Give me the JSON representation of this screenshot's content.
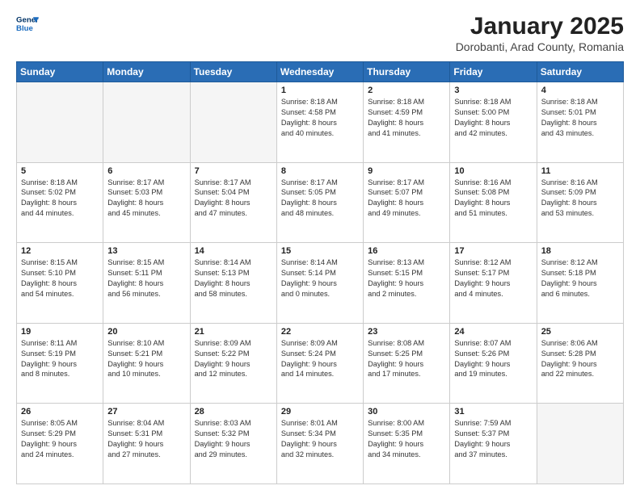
{
  "logo": {
    "line1": "General",
    "line2": "Blue"
  },
  "title": "January 2025",
  "subtitle": "Dorobanti, Arad County, Romania",
  "weekdays": [
    "Sunday",
    "Monday",
    "Tuesday",
    "Wednesday",
    "Thursday",
    "Friday",
    "Saturday"
  ],
  "weeks": [
    [
      {
        "day": "",
        "info": ""
      },
      {
        "day": "",
        "info": ""
      },
      {
        "day": "",
        "info": ""
      },
      {
        "day": "1",
        "info": "Sunrise: 8:18 AM\nSunset: 4:58 PM\nDaylight: 8 hours\nand 40 minutes."
      },
      {
        "day": "2",
        "info": "Sunrise: 8:18 AM\nSunset: 4:59 PM\nDaylight: 8 hours\nand 41 minutes."
      },
      {
        "day": "3",
        "info": "Sunrise: 8:18 AM\nSunset: 5:00 PM\nDaylight: 8 hours\nand 42 minutes."
      },
      {
        "day": "4",
        "info": "Sunrise: 8:18 AM\nSunset: 5:01 PM\nDaylight: 8 hours\nand 43 minutes."
      }
    ],
    [
      {
        "day": "5",
        "info": "Sunrise: 8:18 AM\nSunset: 5:02 PM\nDaylight: 8 hours\nand 44 minutes."
      },
      {
        "day": "6",
        "info": "Sunrise: 8:17 AM\nSunset: 5:03 PM\nDaylight: 8 hours\nand 45 minutes."
      },
      {
        "day": "7",
        "info": "Sunrise: 8:17 AM\nSunset: 5:04 PM\nDaylight: 8 hours\nand 47 minutes."
      },
      {
        "day": "8",
        "info": "Sunrise: 8:17 AM\nSunset: 5:05 PM\nDaylight: 8 hours\nand 48 minutes."
      },
      {
        "day": "9",
        "info": "Sunrise: 8:17 AM\nSunset: 5:07 PM\nDaylight: 8 hours\nand 49 minutes."
      },
      {
        "day": "10",
        "info": "Sunrise: 8:16 AM\nSunset: 5:08 PM\nDaylight: 8 hours\nand 51 minutes."
      },
      {
        "day": "11",
        "info": "Sunrise: 8:16 AM\nSunset: 5:09 PM\nDaylight: 8 hours\nand 53 minutes."
      }
    ],
    [
      {
        "day": "12",
        "info": "Sunrise: 8:15 AM\nSunset: 5:10 PM\nDaylight: 8 hours\nand 54 minutes."
      },
      {
        "day": "13",
        "info": "Sunrise: 8:15 AM\nSunset: 5:11 PM\nDaylight: 8 hours\nand 56 minutes."
      },
      {
        "day": "14",
        "info": "Sunrise: 8:14 AM\nSunset: 5:13 PM\nDaylight: 8 hours\nand 58 minutes."
      },
      {
        "day": "15",
        "info": "Sunrise: 8:14 AM\nSunset: 5:14 PM\nDaylight: 9 hours\nand 0 minutes."
      },
      {
        "day": "16",
        "info": "Sunrise: 8:13 AM\nSunset: 5:15 PM\nDaylight: 9 hours\nand 2 minutes."
      },
      {
        "day": "17",
        "info": "Sunrise: 8:12 AM\nSunset: 5:17 PM\nDaylight: 9 hours\nand 4 minutes."
      },
      {
        "day": "18",
        "info": "Sunrise: 8:12 AM\nSunset: 5:18 PM\nDaylight: 9 hours\nand 6 minutes."
      }
    ],
    [
      {
        "day": "19",
        "info": "Sunrise: 8:11 AM\nSunset: 5:19 PM\nDaylight: 9 hours\nand 8 minutes."
      },
      {
        "day": "20",
        "info": "Sunrise: 8:10 AM\nSunset: 5:21 PM\nDaylight: 9 hours\nand 10 minutes."
      },
      {
        "day": "21",
        "info": "Sunrise: 8:09 AM\nSunset: 5:22 PM\nDaylight: 9 hours\nand 12 minutes."
      },
      {
        "day": "22",
        "info": "Sunrise: 8:09 AM\nSunset: 5:24 PM\nDaylight: 9 hours\nand 14 minutes."
      },
      {
        "day": "23",
        "info": "Sunrise: 8:08 AM\nSunset: 5:25 PM\nDaylight: 9 hours\nand 17 minutes."
      },
      {
        "day": "24",
        "info": "Sunrise: 8:07 AM\nSunset: 5:26 PM\nDaylight: 9 hours\nand 19 minutes."
      },
      {
        "day": "25",
        "info": "Sunrise: 8:06 AM\nSunset: 5:28 PM\nDaylight: 9 hours\nand 22 minutes."
      }
    ],
    [
      {
        "day": "26",
        "info": "Sunrise: 8:05 AM\nSunset: 5:29 PM\nDaylight: 9 hours\nand 24 minutes."
      },
      {
        "day": "27",
        "info": "Sunrise: 8:04 AM\nSunset: 5:31 PM\nDaylight: 9 hours\nand 27 minutes."
      },
      {
        "day": "28",
        "info": "Sunrise: 8:03 AM\nSunset: 5:32 PM\nDaylight: 9 hours\nand 29 minutes."
      },
      {
        "day": "29",
        "info": "Sunrise: 8:01 AM\nSunset: 5:34 PM\nDaylight: 9 hours\nand 32 minutes."
      },
      {
        "day": "30",
        "info": "Sunrise: 8:00 AM\nSunset: 5:35 PM\nDaylight: 9 hours\nand 34 minutes."
      },
      {
        "day": "31",
        "info": "Sunrise: 7:59 AM\nSunset: 5:37 PM\nDaylight: 9 hours\nand 37 minutes."
      },
      {
        "day": "",
        "info": ""
      }
    ]
  ]
}
